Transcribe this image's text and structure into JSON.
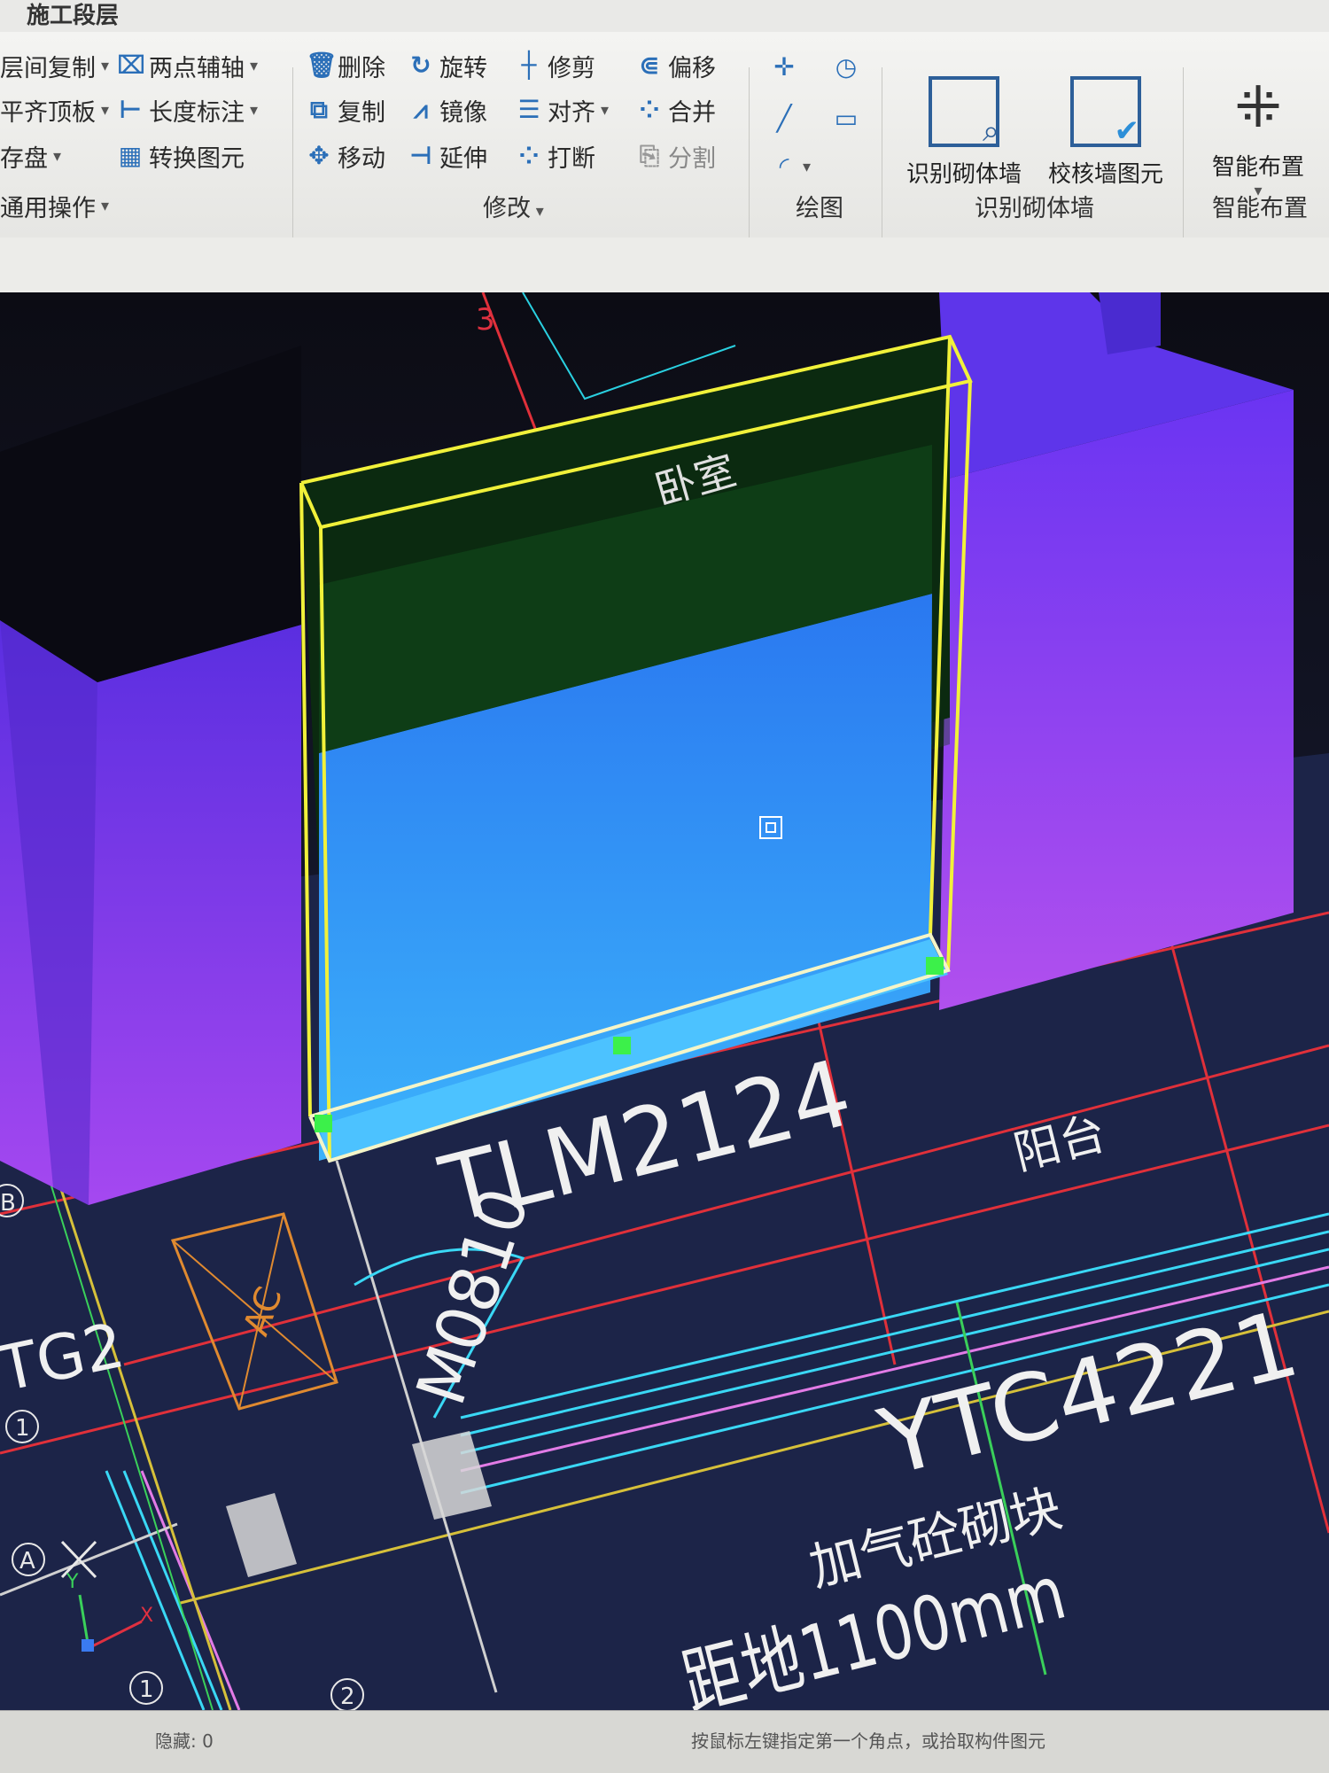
{
  "app_title": "施工段层",
  "ribbon": {
    "general_group": {
      "items": [
        "层间复制",
        "平齐顶板",
        "存盘",
        "通用操作"
      ]
    },
    "axis_group": {
      "items": [
        "两点辅轴",
        "长度标注",
        "转换图元"
      ]
    },
    "modify_group": {
      "label": "修改",
      "items": [
        "删除",
        "旋转",
        "修剪",
        "偏移",
        "复制",
        "镜像",
        "对齐",
        "合并",
        "移动",
        "延伸",
        "打断",
        "分割"
      ]
    },
    "draw_group": {
      "label": "绘图"
    },
    "recognize_group": {
      "label": "识别砌体墙",
      "buttons": [
        "识别砌体墙",
        "校核墙图元"
      ]
    },
    "smart_group": {
      "label": "智能布置",
      "buttons": [
        "智能布置"
      ]
    }
  },
  "cad": {
    "room_bedroom": "卧室",
    "axis_3": "3",
    "door_label": "TLM2124",
    "room_balcony": "阳台",
    "window_label": "M0810",
    "tg_label": "TG2",
    "ac_label": "AC",
    "window_code": "YTC4221",
    "material": "加气砼砌块",
    "sill_height": "距地1100mm",
    "axis_b": "B",
    "axis_a": "A",
    "axis_1": "1",
    "axis_1b": "1",
    "axis_2": "2",
    "coord_y": "Y",
    "coord_x": "X"
  },
  "status": {
    "hidden": "隐藏: 0",
    "hint": "按鼠标左键指定第一个角点，或拾取构件图元"
  },
  "colors": {
    "wall_purple": "#7b3cf0",
    "selected_wall_blue": "#2f8cf5",
    "selection_yellow": "#f1f13a",
    "grip_green": "#3cf04a"
  }
}
